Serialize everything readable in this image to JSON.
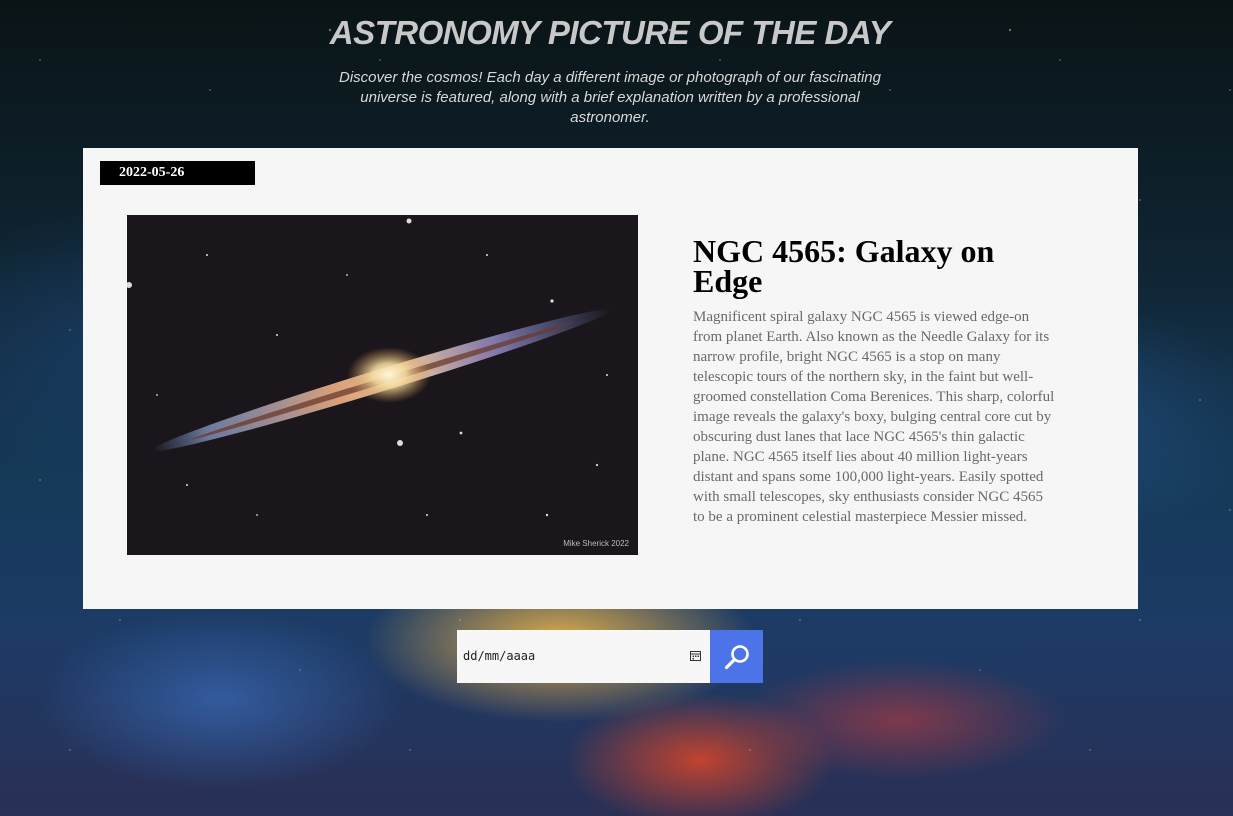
{
  "header": {
    "title": "ASTRONOMY PICTURE OF THE DAY",
    "subtitle": "Discover the cosmos! Each day a different image or photograph of our fascinating universe is featured, along with a brief explanation written by a professional astronomer."
  },
  "apod": {
    "date": "2022-05-26",
    "title": "NGC 4565: Galaxy on Edge",
    "image_credit": "Mike Sherick 2022",
    "explanation": "Magnificent spiral galaxy NGC 4565 is viewed edge-on from planet Earth. Also known as the Needle Galaxy for its narrow profile, bright NGC 4565 is a stop on many telescopic tours of the northern sky, in the faint but well-groomed constellation Coma Berenices. This sharp, colorful image reveals the galaxy's boxy, bulging central core cut by obscuring dust lanes that lace NGC 4565's thin galactic plane. NGC 4565 itself lies about 40 million light-years distant and spans some 100,000 light-years. Easily spotted with small telescopes, sky enthusiasts consider NGC 4565 to be a prominent celestial masterpiece Messier missed."
  },
  "search": {
    "date_placeholder": "dd/mm/aaaa",
    "calendar_icon": "calendar-icon",
    "button_icon": "search-icon",
    "button_color": "#4d73e8"
  }
}
